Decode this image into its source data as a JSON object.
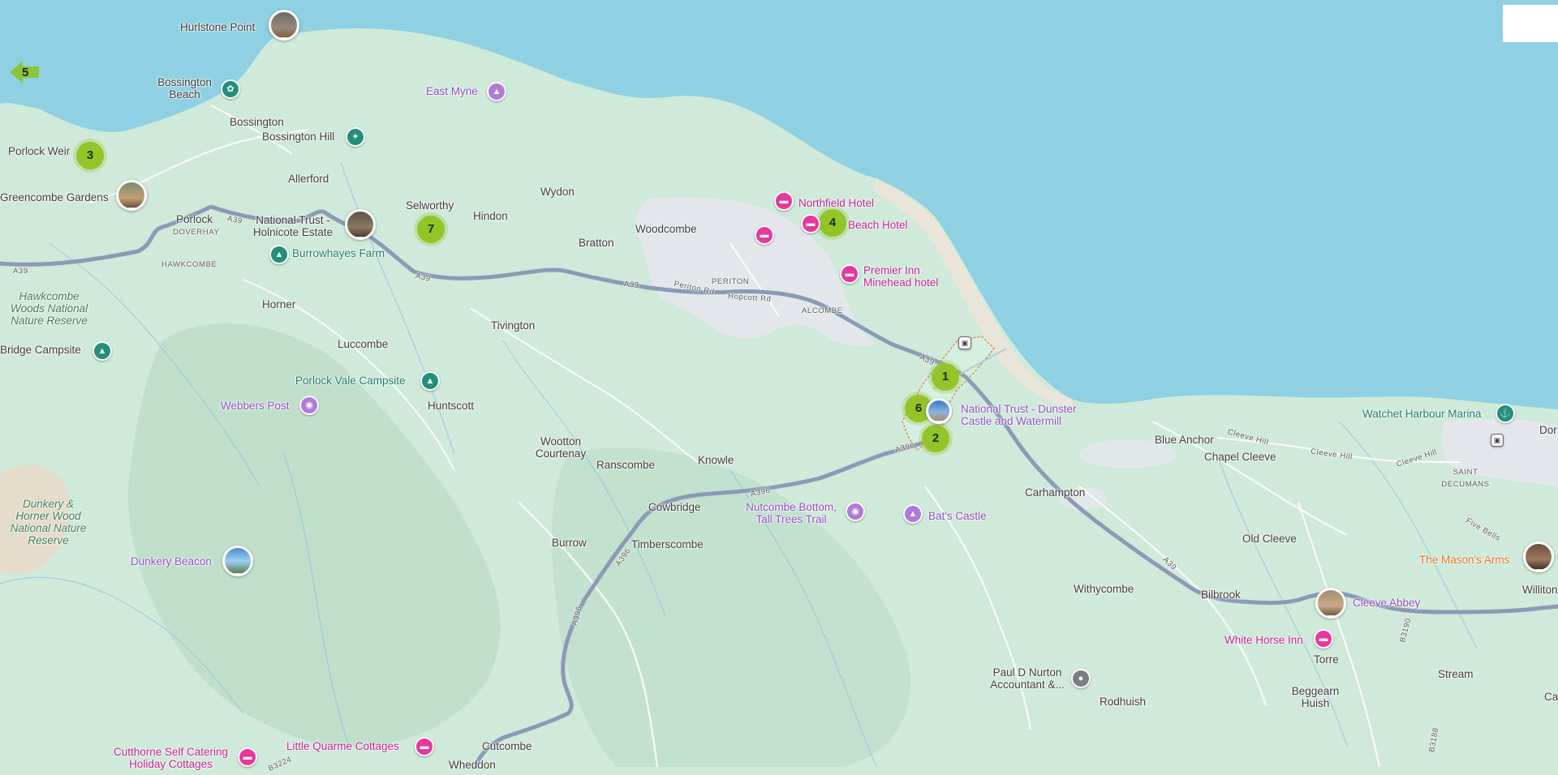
{
  "map": {
    "sea_color": "#8fd0e3",
    "land_color": "#cfe9da",
    "road_color": "#8b9bb6",
    "town_color": "#e6e9ee"
  },
  "controls": {
    "back_button_number": "5",
    "back_button_color": "#8cc43c"
  },
  "clusters": [
    {
      "id": "cluster-1",
      "count": "1"
    },
    {
      "id": "cluster-2",
      "count": "2"
    },
    {
      "id": "cluster-3",
      "count": "3"
    },
    {
      "id": "cluster-4",
      "count": "4"
    },
    {
      "id": "cluster-6",
      "count": "6"
    },
    {
      "id": "cluster-7",
      "count": "7"
    }
  ],
  "places": {
    "hurlstone_point": "Hurlstone Point",
    "bossington_beach": "Bossington Beach",
    "east_myne": "East Myne",
    "bossington": "Bossington",
    "bossington_hill": "Bossington Hill",
    "porlock_weir": "Porlock Weir",
    "allerford": "Allerford",
    "greencombe_gardens": "Greencombe Gardens",
    "wydon": "Wydon",
    "selworthy": "Selworthy",
    "porlock": "Porlock",
    "doverhay": "DOVERHAY",
    "national_trust_holnicote": "National Trust - Holnicote Estate",
    "hindon": "Hindon",
    "bratton": "Bratton",
    "woodcombe": "Woodcombe",
    "northfield_hotel": "Northfield Hotel",
    "beach_hotel": "Beach Hotel",
    "hawkcombe": "HAWKCOMBE",
    "burrowhayes_farm": "Burrowhayes Farm",
    "hawkcombe_woods": "Hawkcombe Woods National Nature Reserve",
    "periton": "PERITON",
    "premier_inn": "Premier Inn Minehead hotel",
    "horner": "Horner",
    "alcombe": "ALCOMBE",
    "tivington": "Tivington",
    "bridge_campsite": "Bridge Campsite",
    "luccombe": "Luccombe",
    "porlock_vale_campsite": "Porlock Vale Campsite",
    "webbers_post": "Webbers Post",
    "huntscott": "Huntscott",
    "nt_dunster": "National Trust - Dunster Castle and Watermill",
    "watchet_harbour_marina": "Watchet Harbour Marina",
    "blue_anchor": "Blue Anchor",
    "chapel_cleeve": "Chapel Cleeve",
    "wootton_courtenay": "Wootton Courtenay",
    "ranscombe": "Ranscombe",
    "knowle": "Knowle",
    "saint_decumans": "SAINT DECUMANS",
    "carhampton": "Carhampton",
    "dunkery_horner_wood": "Dunkery & Horner Wood National Nature Reserve",
    "cowbridge": "Cowbridge",
    "nutcombe_bottom": "Nutcombe Bottom, Tall Trees Trail",
    "bats_castle": "Bat's Castle",
    "burrow": "Burrow",
    "timberscombe": "Timberscombe",
    "old_cleeve": "Old Cleeve",
    "masons_arms": "The Mason's Arms",
    "dunkery_beacon": "Dunkery Beacon",
    "withycombe": "Withycombe",
    "bilbrook": "Bilbrook",
    "cleeve_abbey": "Cleeve Abbey",
    "williton": "Williton",
    "white_horse_inn": "White Horse Inn",
    "torre": "Torre",
    "paul_nurton": "Paul D Nurton Accountant &...",
    "stream": "Stream",
    "rodhuish": "Rodhuish",
    "beggearn_huish": "Beggearn Huish",
    "cutthorne": "Cutthorne Self Catering Holiday Cottages",
    "little_quarme": "Little Quarme Cottages",
    "cutcombe": "Cutcombe",
    "wheddon": "Wheddon",
    "dor": "Dor",
    "cad": "Ca"
  },
  "roads": {
    "a39_labels": [
      "A39",
      "A39",
      "A39",
      "A39",
      "A39",
      "A39"
    ],
    "a396_labels": [
      "A396",
      "A396",
      "A396",
      "A396"
    ],
    "b3190": "B3190",
    "b3188": "B3188",
    "b3224": "B3224",
    "periton_rd": "Periton Rd",
    "hopcott_rd": "Hopcott Rd",
    "cleeve_hill": "Cleeve Hill",
    "five_bells": "Five Bells"
  }
}
